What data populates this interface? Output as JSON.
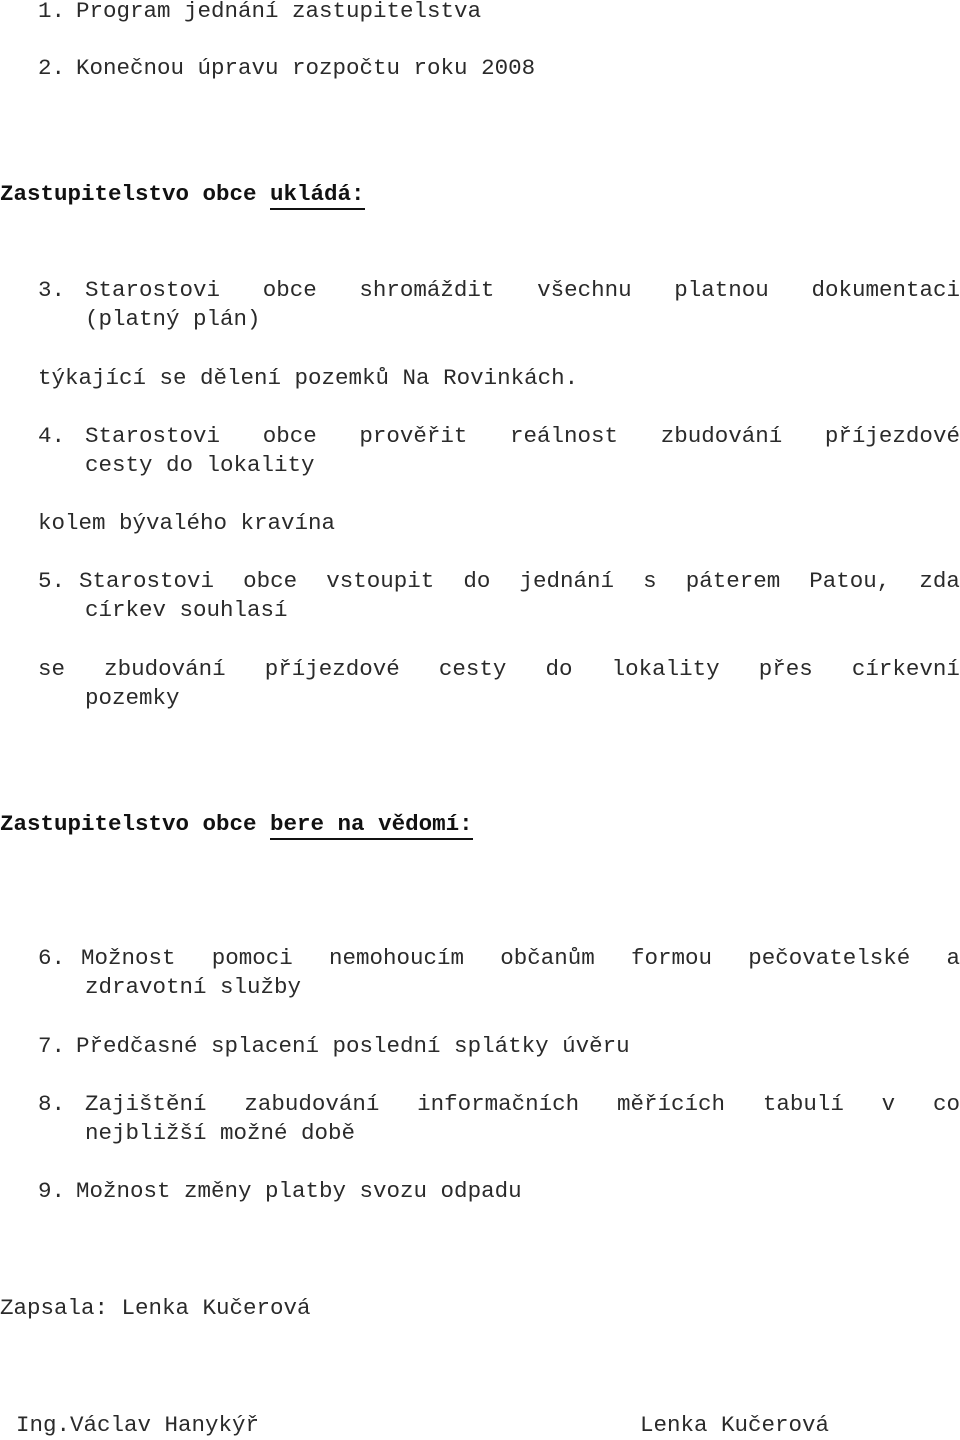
{
  "items_top": [
    {
      "num": "1.",
      "text": "Program jednání zastupitelstva"
    },
    {
      "num": "2.",
      "text": "Konečnou úpravu rozpočtu roku 2008"
    }
  ],
  "section1": {
    "prefix": "Zastupitelstvo obce ",
    "underlined": "ukládá:"
  },
  "item3": {
    "num": "3.",
    "words": [
      "Starostovi",
      "obce",
      "shromáždit",
      "všechnu",
      "platnou",
      "dokumentaci"
    ],
    "cont": "(platný plán)",
    "after": "týkající se dělení pozemků Na Rovinkách."
  },
  "item4": {
    "num": "4.",
    "words": [
      "Starostovi",
      "obce",
      "prověřit",
      "reálnost",
      "zbudování",
      "příjezdové"
    ],
    "cont": "cesty do lokality",
    "after": "kolem bývalého kravína"
  },
  "item5": {
    "num": "5.",
    "words": [
      "Starostovi",
      "obce",
      "vstoupit",
      "do",
      "jednání",
      "s",
      "páterem",
      "Patou,",
      "zda"
    ],
    "cont": "církev souhlasí",
    "after_words": [
      "se",
      "zbudování",
      "příjezdové",
      "cesty",
      "do",
      "lokality",
      "přes",
      "církevní"
    ],
    "after_cont": "pozemky"
  },
  "section2": {
    "prefix": "Zastupitelstvo obce ",
    "underlined": "bere na vědomí:"
  },
  "item6": {
    "num": "6.",
    "words": [
      "Možnost",
      "pomoci",
      "nemohoucím",
      "občanům",
      "formou",
      "pečovatelské",
      "a"
    ],
    "cont": "zdravotní služby"
  },
  "item7": {
    "num": "7.",
    "text": "Předčasné splacení poslední splátky úvěru"
  },
  "item8": {
    "num": "8.",
    "words": [
      "Zajištění",
      "zabudování",
      "informačních",
      "měřících",
      "tabulí",
      "v",
      "co"
    ],
    "cont": "nejbližší možné době"
  },
  "item9": {
    "num": "9.",
    "text": "Možnost změny platby svozu odpadu"
  },
  "recorder": "Zapsala: Lenka Kučerová",
  "signatures": {
    "left": "Ing.Václav Hanykýř",
    "right": "Lenka Kučerová"
  }
}
